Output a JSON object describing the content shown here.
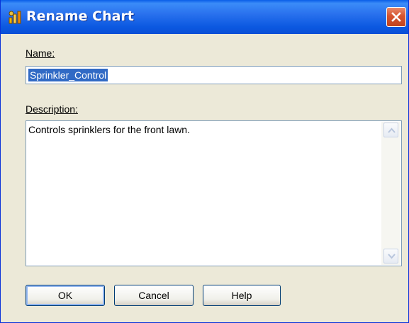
{
  "window": {
    "title": "Rename Chart",
    "icon": "chart-app-icon",
    "close_icon": "close-icon"
  },
  "name_field": {
    "label": "Name:",
    "value": "Sprinkler_Control",
    "selected": true
  },
  "description_field": {
    "label": "Description:",
    "value": "Controls sprinklers for the front lawn."
  },
  "buttons": {
    "ok": "OK",
    "cancel": "Cancel",
    "help": "Help"
  },
  "colors": {
    "titlebar": "#0a5ee8",
    "selection": "#316ac5",
    "close_button": "#d6532e",
    "dialog_background": "#ece9d8"
  }
}
